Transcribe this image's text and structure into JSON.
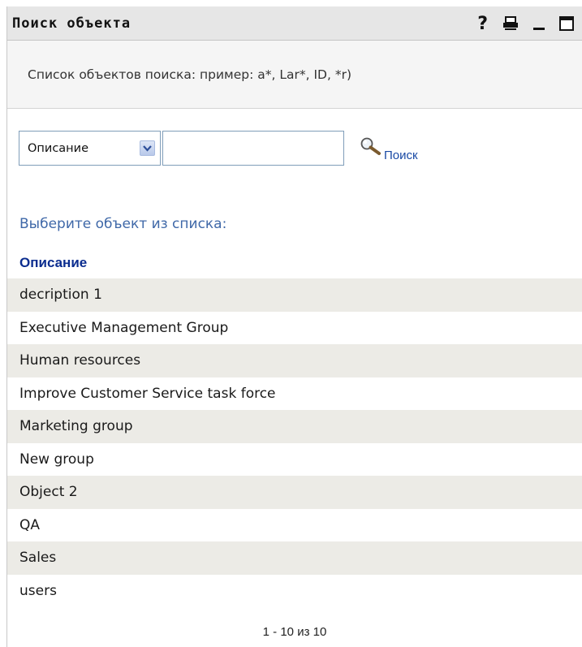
{
  "titlebar": {
    "title": "Поиск объекта",
    "icons": [
      "help-icon",
      "print-icon",
      "minimize-icon",
      "maximize-icon"
    ],
    "help_glyph": "?"
  },
  "instructions": "Список объектов поиска: пример: a*, Lar*, ID, *r)",
  "search": {
    "field_selected": "Описание",
    "input_value": "",
    "button_label": "Поиск"
  },
  "list": {
    "prompt": "Выберите объект из списка:",
    "column_header": "Описание",
    "items": [
      "decription 1",
      "Executive Management Group",
      "Human resources",
      "Improve Customer Service task force",
      "Marketing group",
      "New group",
      "Object 2",
      "QA",
      "Sales",
      "users"
    ]
  },
  "pager": "1 - 10 из 10",
  "colors": {
    "link": "#1a4aa5",
    "header": "#0b2d8f",
    "prompt": "#3f68a8",
    "row_alt": "#ecebe6"
  }
}
